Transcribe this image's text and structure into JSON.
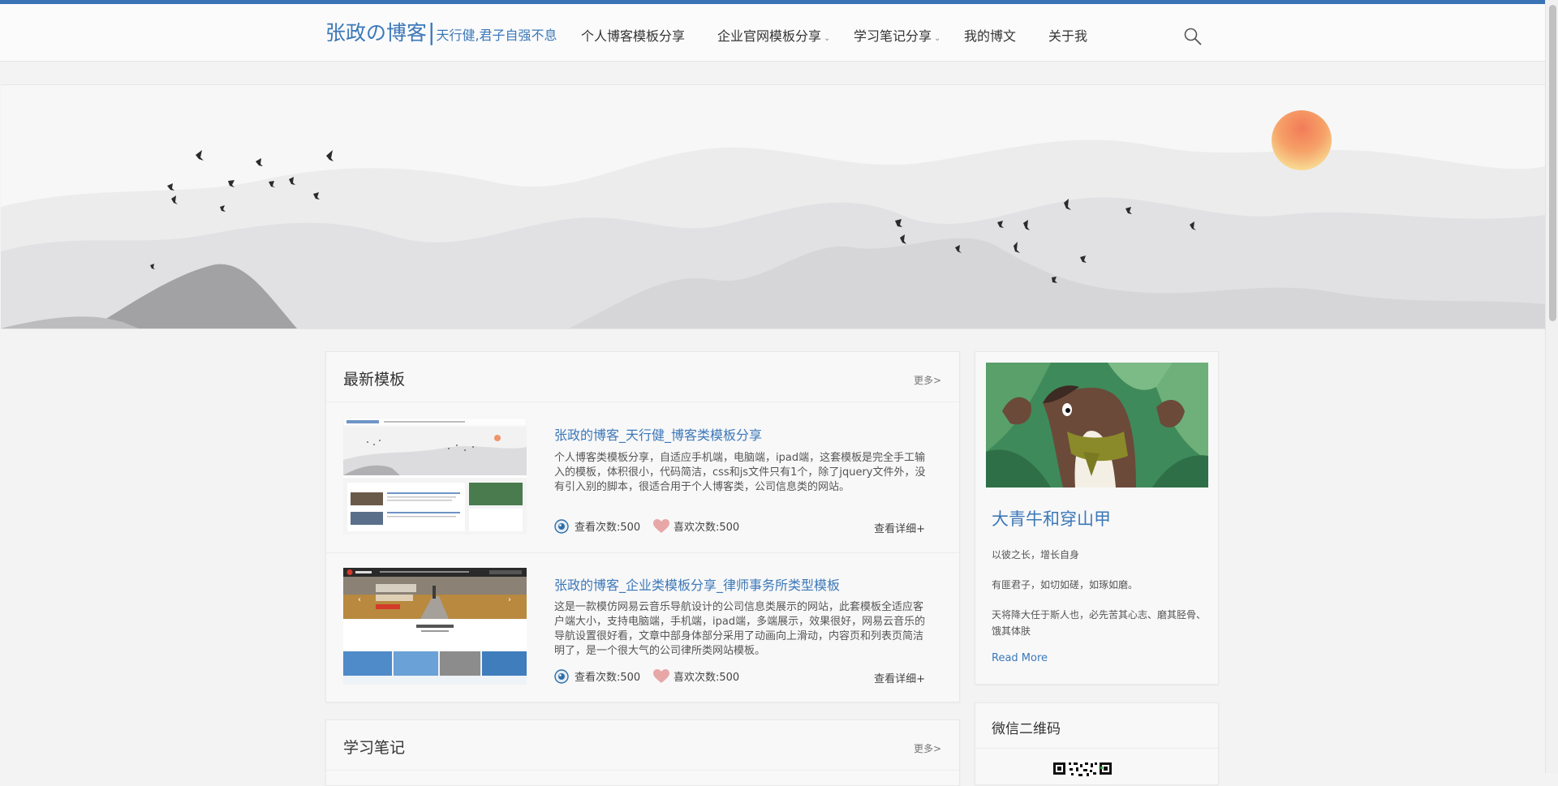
{
  "header": {
    "logo_main": "张政の博客",
    "logo_bar": "|",
    "logo_sub": "天行健,君子自强不息",
    "nav": [
      {
        "label": "个人博客模板分享",
        "dropdown": false
      },
      {
        "label": "企业官网模板分享",
        "dropdown": true
      },
      {
        "label": "学习笔记分享",
        "dropdown": true
      },
      {
        "label": "我的博文",
        "dropdown": false
      },
      {
        "label": "关于我",
        "dropdown": false
      }
    ],
    "chevron": "⌄",
    "search_icon": "search-icon"
  },
  "templates": {
    "title": "最新模板",
    "more": "更多>",
    "items": [
      {
        "title": "张政的博客_天行健_博客类模板分享",
        "desc": "个人博客类模板分享，自适应手机端，电脑端，ipad端，这套模板是完全手工输入的模板，体积很小，代码简洁，css和js文件只有1个，除了jquery文件外，没有引入别的脚本，很适合用于个人博客类，公司信息类的网站。",
        "views": "查看次数:500",
        "likes": "喜欢次数:500",
        "detail": "查看详细+"
      },
      {
        "title": "张政的博客_企业类模板分享_律师事务所类型模板",
        "desc": "这是一款模仿网易云音乐导航设计的公司信息类展示的网站，此套模板全适应客户端大小，支持电脑端，手机端，ipad端，多端展示，效果很好，网易云音乐的导航设置很好看，文章中部身体部分采用了动画向上滑动，内容页和列表页简洁明了，是一个很大气的公司律所类网站模板。",
        "views": "查看次数:500",
        "likes": "喜欢次数:500",
        "detail": "查看详细+"
      }
    ]
  },
  "notes": {
    "title": "学习笔记",
    "more": "更多>"
  },
  "profile": {
    "name": "大青牛和穿山甲",
    "lines": [
      "以彼之长，增长自身",
      "有匪君子，如切如磋，如琢如磨。",
      "天将降大任于斯人也，必先苦其心志、磨其胫骨、饿其体肤"
    ],
    "read_more": "Read More"
  },
  "wechat": {
    "title": "微信二维码"
  },
  "colors": {
    "accent": "#3c78b8",
    "topline": "#3a73b6",
    "like": "#e8a7a7"
  }
}
